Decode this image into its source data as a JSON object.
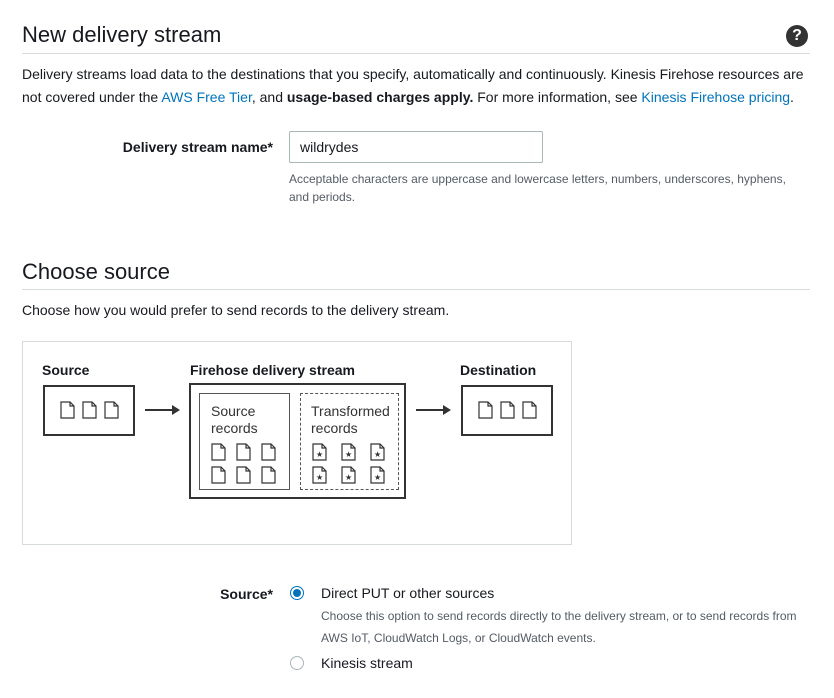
{
  "header": {
    "title": "New delivery stream",
    "help_icon": "question-circle-icon"
  },
  "intro": {
    "text1": "Delivery streams load data to the destinations that you specify, automatically and continuously. Kinesis Firehose resources are not covered under the ",
    "link_free_tier": "AWS Free Tier",
    "text2": ", and ",
    "bold_charges": "usage-based charges apply.",
    "text3": " For more information, see ",
    "link_pricing": "Kinesis Firehose pricing",
    "text4": "."
  },
  "stream_name": {
    "label": "Delivery stream name*",
    "value": "wildrydes",
    "hint": "Acceptable characters are uppercase and lowercase letters, numbers, underscores, hyphens, and periods."
  },
  "source_section": {
    "title": "Choose source",
    "description": "Choose how you would prefer to send records to the delivery stream."
  },
  "diagram": {
    "source_label": "Source",
    "firehose_label": "Firehose delivery stream",
    "destination_label": "Destination",
    "source_records": "Source records",
    "transformed_records": "Transformed records",
    "icons": [
      "document-icon",
      "arrow-right-icon",
      "star-document-icon"
    ]
  },
  "source_radio": {
    "label": "Source*",
    "options": [
      {
        "label": "Direct PUT or other sources",
        "description": "Choose this option to send records directly to the delivery stream, or to send records from AWS IoT, CloudWatch Logs, or CloudWatch events.",
        "selected": true
      },
      {
        "label": "Kinesis stream",
        "selected": false
      }
    ]
  },
  "colors": {
    "link": "#0073bb",
    "radio_selected": "#0073bb",
    "text": "#16191f"
  }
}
